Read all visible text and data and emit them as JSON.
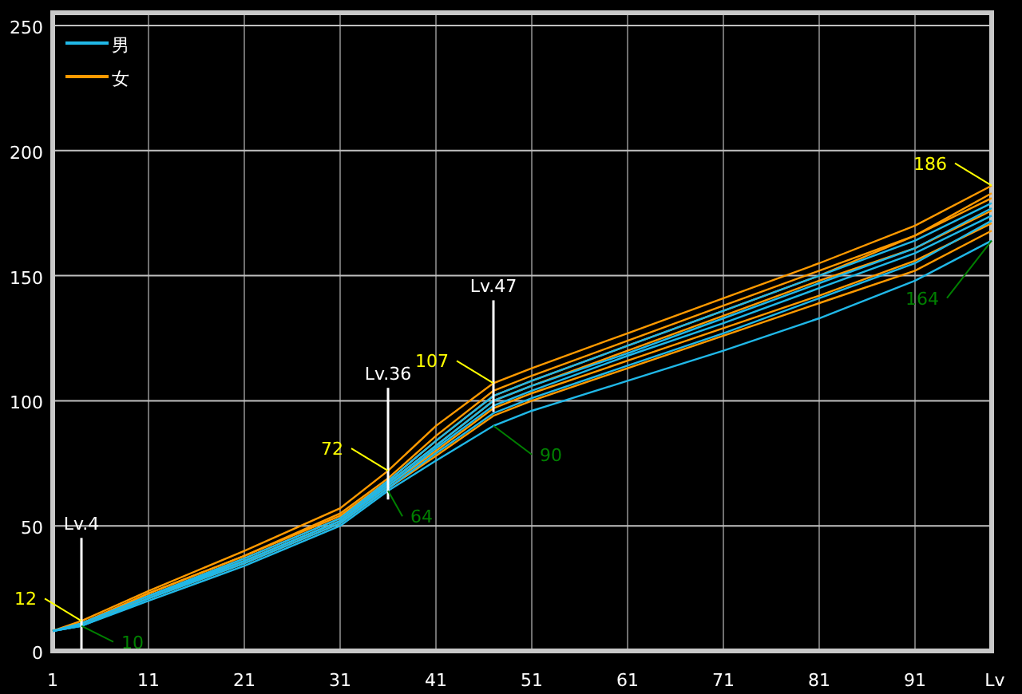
{
  "legend": [
    {
      "label": "男",
      "color": "#20b8e8"
    },
    {
      "label": "女",
      "color": "#ff9a00"
    }
  ],
  "chart_data": {
    "type": "line",
    "xlabel": "Lv",
    "grid": true,
    "x": [
      1,
      4,
      11,
      21,
      31,
      36,
      41,
      47,
      51,
      61,
      71,
      81,
      91,
      99
    ],
    "xlim": [
      1,
      99
    ],
    "ylim": [
      0,
      250
    ],
    "xticks": [
      1,
      11,
      21,
      31,
      41,
      51,
      61,
      71,
      81,
      91
    ],
    "yticks": [
      0,
      50,
      100,
      150,
      200,
      250
    ],
    "series": [
      {
        "color": "#ff9a00",
        "values": [
          8,
          12,
          24,
          40,
          57,
          72,
          90,
          107,
          113,
          127,
          141,
          155,
          170,
          186
        ]
      },
      {
        "color": "#ff9a00",
        "values": [
          8,
          11,
          23,
          38,
          55,
          69,
          86,
          104,
          110,
          124,
          138,
          152,
          166,
          181
        ]
      },
      {
        "color": "#ff9a00",
        "values": [
          8,
          11,
          22,
          37,
          53,
          67,
          82,
          100,
          106,
          120,
          134,
          148,
          161,
          176
        ]
      },
      {
        "color": "#ff9a00",
        "values": [
          8,
          11,
          22,
          36,
          52,
          66,
          80,
          97,
          103,
          116,
          129,
          142,
          156,
          171
        ]
      },
      {
        "color": "#ff9a00",
        "values": [
          8,
          11,
          21,
          35,
          51,
          65,
          78,
          94,
          100,
          113,
          126,
          139,
          152,
          168
        ]
      },
      {
        "color": "#ff9a00",
        "values": [
          8,
          11,
          23,
          38,
          54,
          68,
          84,
          102,
          108,
          122,
          136,
          150,
          166,
          183
        ]
      },
      {
        "color": "#20b8e8",
        "values": [
          8,
          11,
          22,
          37,
          53,
          68,
          84,
          102,
          108,
          122,
          136,
          150,
          164,
          179
        ]
      },
      {
        "color": "#20b8e8",
        "values": [
          8,
          10,
          21,
          36,
          52,
          66,
          81,
          98,
          104,
          118,
          131,
          145,
          159,
          174
        ]
      },
      {
        "color": "#20b8e8",
        "values": [
          8,
          10,
          21,
          35,
          51,
          65,
          79,
          95,
          101,
          114,
          127,
          141,
          155,
          172
        ]
      },
      {
        "color": "#20b8e8",
        "values": [
          8,
          10,
          20,
          34,
          50,
          64,
          76,
          90,
          96,
          108,
          120,
          133,
          148,
          164
        ]
      },
      {
        "color": "#20b8e8",
        "values": [
          8,
          11,
          22,
          36,
          52,
          67,
          82,
          100,
          106,
          119,
          133,
          147,
          161,
          177
        ]
      }
    ],
    "annotations": [
      "Lv.4",
      {
        "x": 4,
        "y": 12,
        "text": "12"
      },
      {
        "x": 4,
        "y": 10,
        "text": "10"
      },
      "Lv.36",
      {
        "x": 36,
        "y": 72,
        "text": "72"
      },
      {
        "x": 36,
        "y": 64,
        "text": "64"
      },
      "Lv.47",
      {
        "x": 47,
        "y": 107,
        "text": "107"
      },
      {
        "x": 47,
        "y": 90,
        "text": "90"
      },
      {
        "x": 99,
        "y": 186,
        "text": "186"
      },
      {
        "x": 99,
        "y": 164,
        "text": "164"
      }
    ]
  }
}
